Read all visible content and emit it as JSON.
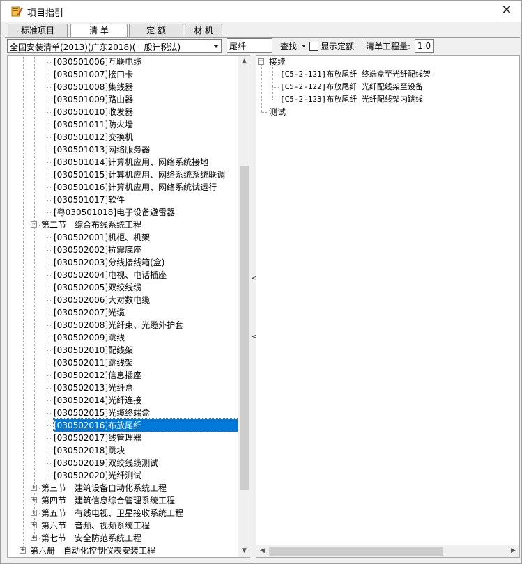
{
  "window": {
    "title": "项目指引",
    "close": "✕"
  },
  "tabs": [
    {
      "label": "标准项目",
      "active": false
    },
    {
      "label": "清 单",
      "active": true
    },
    {
      "label": "定 额",
      "active": false
    },
    {
      "label": "材 机",
      "active": false
    }
  ],
  "toolbar": {
    "library_select": "全国安装清单(2013)(广东2018)(一般计税法)",
    "search_value": "尾纤",
    "find_label": "查找",
    "show_quota_label": "显示定额",
    "show_quota_checked": false,
    "quantity_label": "清单工程量:",
    "quantity_value": "1.0"
  },
  "left_tree": {
    "items": [
      {
        "text": "[030501006]互联电缆",
        "level": 3
      },
      {
        "text": "[030501007]接口卡",
        "level": 3
      },
      {
        "text": "[030501008]集线器",
        "level": 3
      },
      {
        "text": "[030501009]路由器",
        "level": 3
      },
      {
        "text": "[030501010]收发器",
        "level": 3
      },
      {
        "text": "[030501011]防火墙",
        "level": 3
      },
      {
        "text": "[030501012]交换机",
        "level": 3
      },
      {
        "text": "[030501013]网络服务器",
        "level": 3
      },
      {
        "text": "[030501014]计算机应用、网络系统接地",
        "level": 3
      },
      {
        "text": "[030501015]计算机应用、网络系统系统联调",
        "level": 3
      },
      {
        "text": "[030501016]计算机应用、网络系统试运行",
        "level": 3
      },
      {
        "text": "[030501017]软件",
        "level": 3
      },
      {
        "text": "[粤030501018]电子设备避雷器",
        "level": 3
      },
      {
        "text": "第二节　综合布线系统工程",
        "level": 2,
        "expander": "minus"
      },
      {
        "text": "[030502001]机柜、机架",
        "level": 3
      },
      {
        "text": "[030502002]抗震底座",
        "level": 3
      },
      {
        "text": "[030502003]分线接线箱(盒)",
        "level": 3
      },
      {
        "text": "[030502004]电视、电话插座",
        "level": 3
      },
      {
        "text": "[030502005]双绞线缆",
        "level": 3
      },
      {
        "text": "[030502006]大对数电缆",
        "level": 3
      },
      {
        "text": "[030502007]光缆",
        "level": 3
      },
      {
        "text": "[030502008]光纤束、光缆外护套",
        "level": 3
      },
      {
        "text": "[030502009]跳线",
        "level": 3
      },
      {
        "text": "[030502010]配线架",
        "level": 3
      },
      {
        "text": "[030502011]跳线架",
        "level": 3
      },
      {
        "text": "[030502012]信息插座",
        "level": 3
      },
      {
        "text": "[030502013]光纤盒",
        "level": 3
      },
      {
        "text": "[030502014]光纤连接",
        "level": 3
      },
      {
        "text": "[030502015]光缆终端盒",
        "level": 3
      },
      {
        "text": "[030502016]布放尾纤",
        "level": 3,
        "selected": true
      },
      {
        "text": "[030502017]线管理器",
        "level": 3
      },
      {
        "text": "[030502018]跳块",
        "level": 3
      },
      {
        "text": "[030502019]双绞线缆测试",
        "level": 3
      },
      {
        "text": "[030502020]光纤测试",
        "level": 3
      },
      {
        "text": "第三节　建筑设备自动化系统工程",
        "level": 2,
        "expander": "plus"
      },
      {
        "text": "第四节　建筑信息综合管理系统工程",
        "level": 2,
        "expander": "plus"
      },
      {
        "text": "第五节　有线电视、卫星接收系统工程",
        "level": 2,
        "expander": "plus"
      },
      {
        "text": "第六节　音频、视频系统工程",
        "level": 2,
        "expander": "plus"
      },
      {
        "text": "第七节　安全防范系统工程",
        "level": 2,
        "expander": "plus"
      },
      {
        "text": "第六册　自动化控制仪表安装工程",
        "level": 1,
        "expander": "plus"
      }
    ]
  },
  "right_tree": {
    "items": [
      {
        "text": "接续",
        "level": 0,
        "expander": "minus"
      },
      {
        "text": "[C5-2-121]布放尾纤 终端盒至光纤配线架",
        "level": 1
      },
      {
        "text": "[C5-2-122]布放尾纤 光纤配线架至设备",
        "level": 1
      },
      {
        "text": "[C5-2-123]布放尾纤 光纤配线架内跳线",
        "level": 1
      },
      {
        "text": "测试",
        "level": 0
      }
    ]
  },
  "colors": {
    "selection": "#0078d7",
    "window_bg": "#f0f0f0"
  },
  "icons": {
    "app": "notebook-pencil-icon",
    "close": "close-icon"
  }
}
